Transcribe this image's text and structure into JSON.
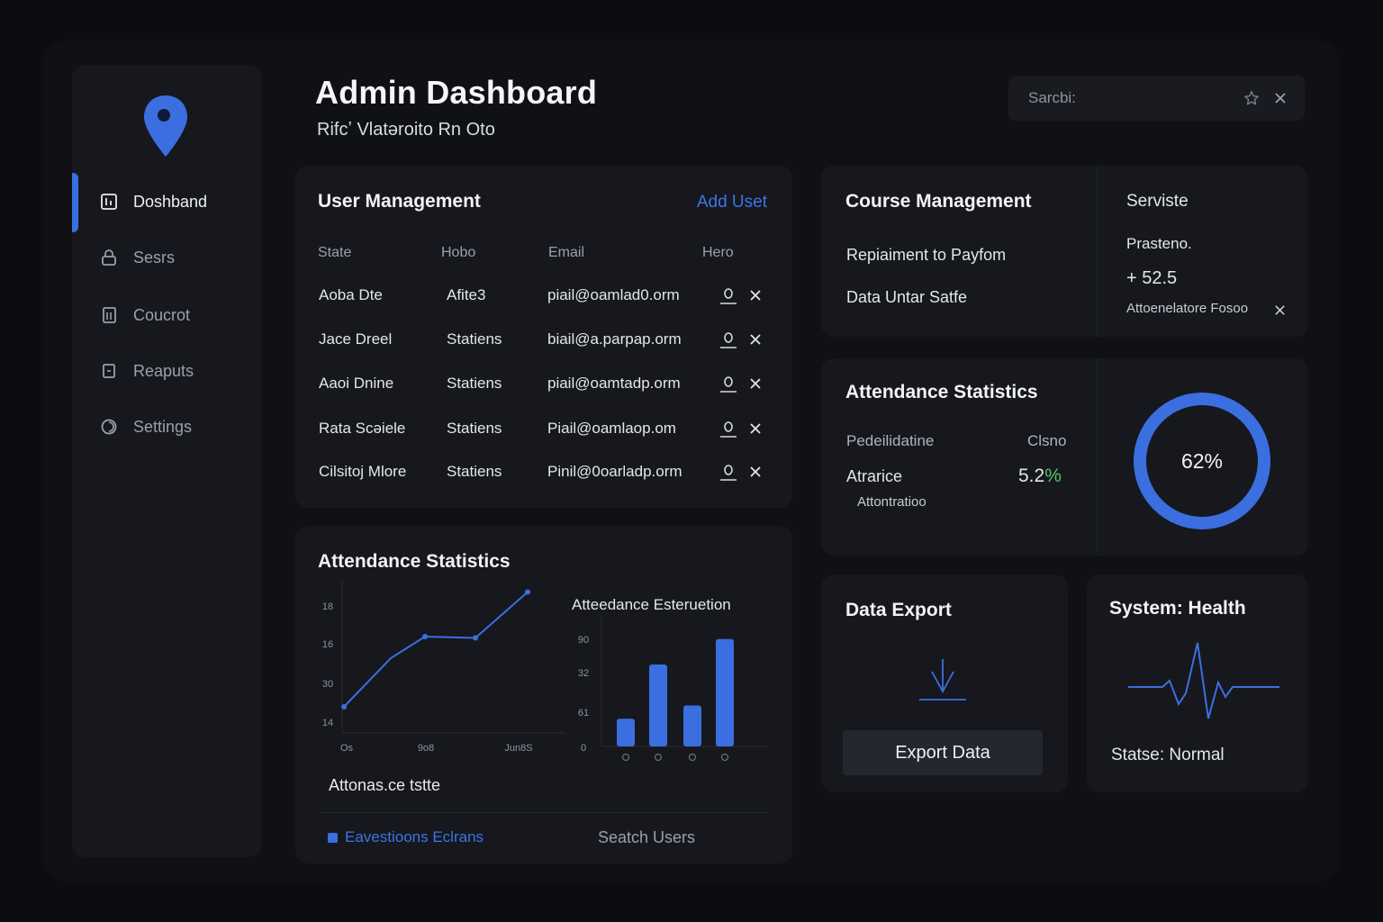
{
  "app": {
    "title": "Admin Dashboard",
    "subtitle": "Rifcʼ Vlatəroito Rn Oto"
  },
  "colors": {
    "accent": "#3b6fe0",
    "background": "#0c0d10",
    "card": "#16181d",
    "positive": "#59c36a"
  },
  "sidebar": {
    "logo_icon": "map-pin-icon",
    "items": [
      {
        "label": "Doshband",
        "icon": "dashboard-icon",
        "active": true
      },
      {
        "label": "Sesrs",
        "icon": "lock-icon",
        "active": false
      },
      {
        "label": "Coucrot",
        "icon": "book-icon",
        "active": false
      },
      {
        "label": "Reaputs",
        "icon": "document-icon",
        "active": false
      },
      {
        "label": "Settings",
        "icon": "settings-icon",
        "active": false
      }
    ]
  },
  "search": {
    "placeholder": "Sarcbi:",
    "icons": [
      "star-icon",
      "close-icon"
    ]
  },
  "user_management": {
    "title": "User Management",
    "add_label": "Add Uset",
    "columns": [
      "State",
      "Hobo",
      "Email",
      "Hero"
    ],
    "rows": [
      {
        "name": "Aoba Dte",
        "status": "Afite3",
        "email": "piail@oamlad0.orm"
      },
      {
        "name": "Jace Dreel",
        "status": "Statiens",
        "email": "biail@a.parpap.orm"
      },
      {
        "name": "Aaoi Dnine",
        "status": "Statiens",
        "email": "piail@oamtadp.orm"
      },
      {
        "name": "Rata Scəiele",
        "status": "Statiens",
        "email": "Piail@oamlaop.om"
      },
      {
        "name": "Cilsitoj Mlore",
        "status": "Statiens",
        "email": "Pinil@0oarladp.orm"
      }
    ]
  },
  "attendance_chart": {
    "title": "Attendance Statistics",
    "bar_title": "Atteedance Esteruetion",
    "footer_title": "Attonas.ce tstte",
    "legend_label": "Eavestioons Eclrans",
    "search_users_label": "Seatch Users"
  },
  "chart_data": [
    {
      "type": "line",
      "x": [
        "Os",
        "",
        "9o8",
        "",
        "Jun8S"
      ],
      "y_ticks": [
        "18",
        "16",
        "30",
        "14"
      ],
      "series": [
        {
          "values": [
            0.06,
            0.42,
            0.58,
            0.57,
            0.91
          ]
        }
      ],
      "ylim": [
        0,
        1
      ]
    },
    {
      "type": "bar",
      "categories": [
        "",
        "",
        "",
        ""
      ],
      "y_ticks": [
        "90",
        "32",
        "61",
        "0"
      ],
      "values": [
        0.25,
        0.74,
        0.37,
        0.97
      ],
      "ylim": [
        0,
        1
      ]
    }
  ],
  "course_management": {
    "title": "Course Management",
    "items": [
      "Repiaiment to Payfom",
      "Data Untar Satfe"
    ],
    "side_title": "Serviste",
    "side_label": "Prasteno.",
    "side_value": "+ 52.5",
    "side_footer": "Attoenelatore Fosoo"
  },
  "attendance_stats": {
    "title": "Attendance Statistics",
    "col1_label": "Pedeilidatine",
    "col2_label": "Clsno",
    "row_label": "Atrarice",
    "row_value": "5.2",
    "row_value_suffix": "%",
    "row_sub": "Attontratioo",
    "donut_label": "62%",
    "donut_percent": 100
  },
  "data_export": {
    "title": "Data Export",
    "icon": "download-icon",
    "button_label": "Export Data"
  },
  "system_health": {
    "title": "System: Health",
    "icon": "heartbeat-icon",
    "status": "Statse: Normal"
  }
}
